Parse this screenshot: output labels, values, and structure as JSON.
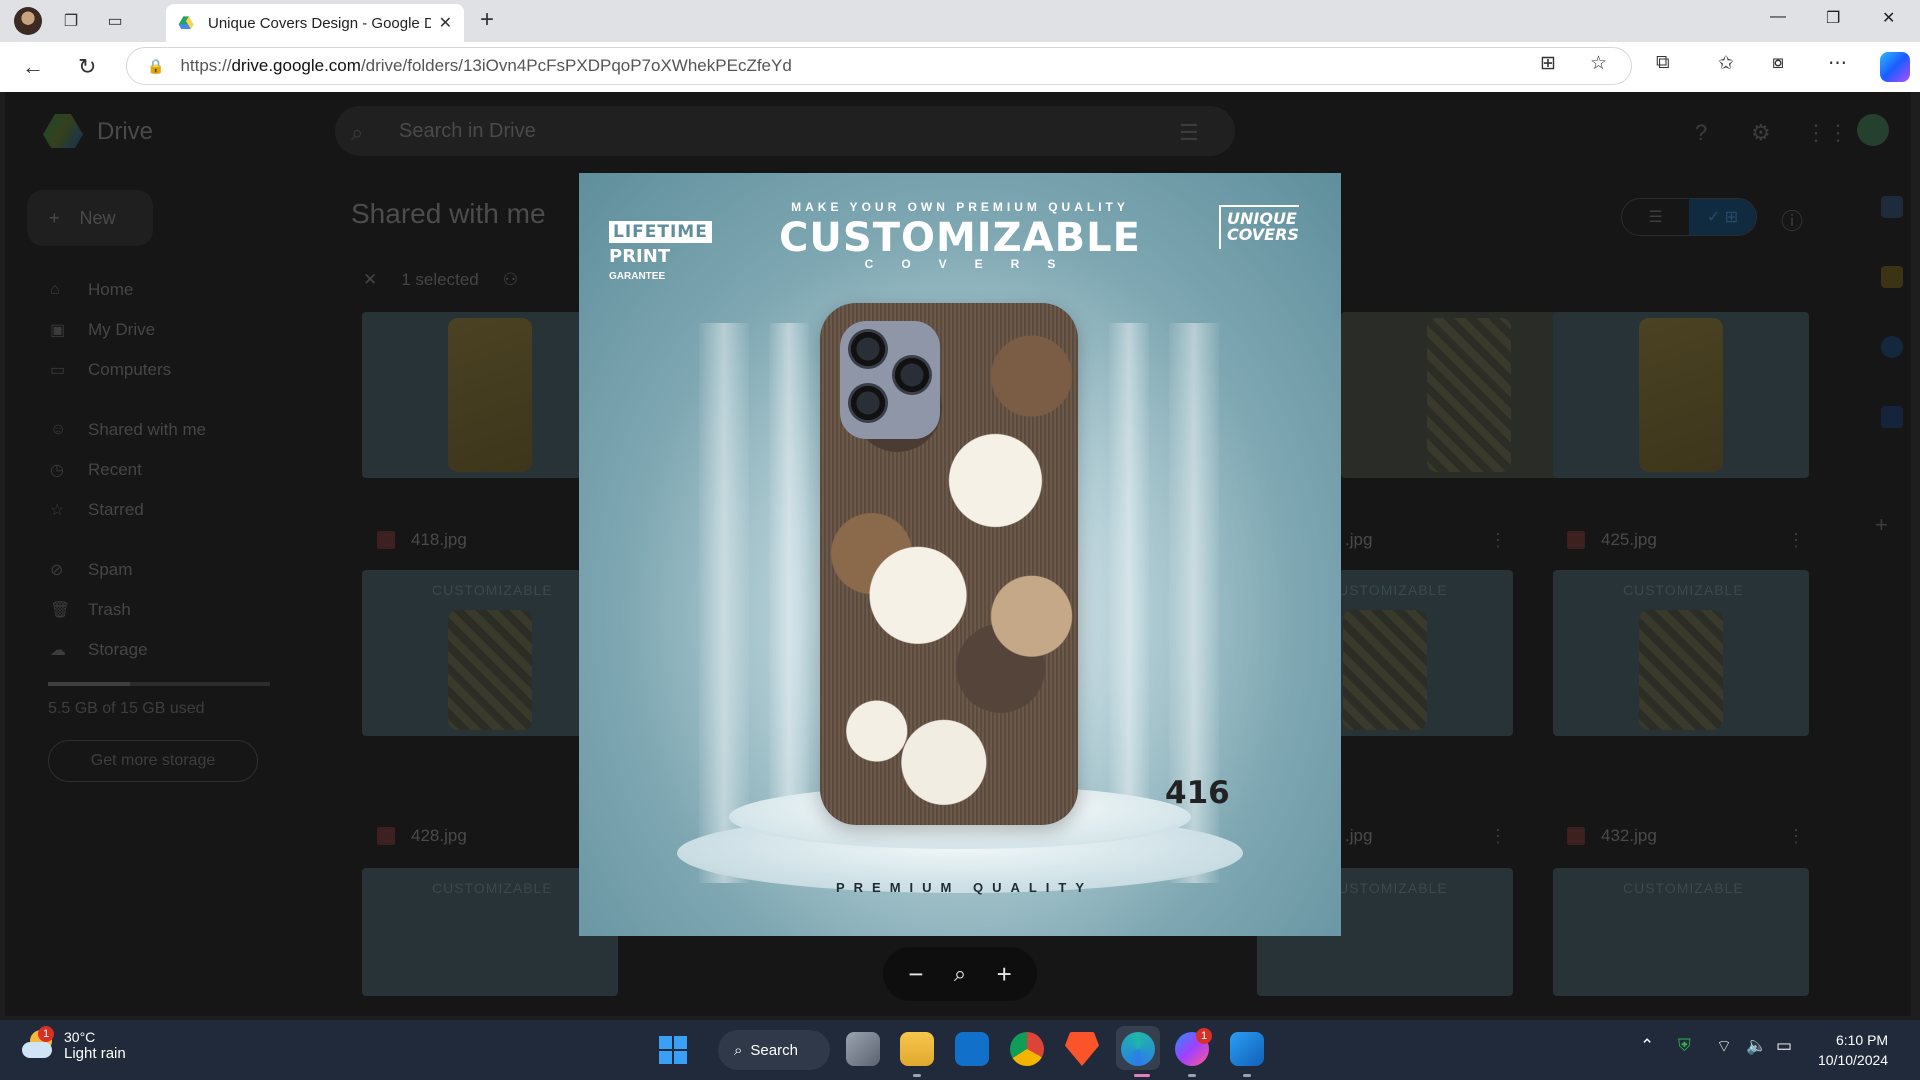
{
  "browser": {
    "tab_title": "Unique Covers Design - Google D",
    "url_prefix": "https://",
    "url_host": "drive.google.com",
    "url_path": "/drive/folders/13iOvn4PcFsPXDPqoP7oXWhekPEcZfeYd"
  },
  "drive": {
    "product": "Drive",
    "search_placeholder": "Search in Drive",
    "new_label": "New",
    "nav": [
      "Home",
      "My Drive",
      "Computers",
      "Shared with me",
      "Recent",
      "Starred",
      "Spam",
      "Trash",
      "Storage"
    ],
    "storage_used_fraction": 0.37,
    "storage_text": "5.5 GB of 15 GB used",
    "get_storage": "Get more storage",
    "page_title": "Shared with me",
    "selected_text": "1 selected",
    "files": [
      "418.jpg",
      ".jpg",
      "425.jpg",
      "428.jpg",
      ".jpg",
      "432.jpg"
    ],
    "thumb_caption": "CUSTOMIZABLE"
  },
  "preview": {
    "lifetime": "LIFETIME",
    "print": "PRINT",
    "guarantee": "GARANTEE",
    "make": "MAKE YOUR OWN PREMIUM QUALITY",
    "customizable": "CUSTOMIZABLE",
    "covers": "COVERS",
    "brand": "UNIQUE COVERS",
    "number": "416",
    "premium": "PREMIUM QUALITY"
  },
  "taskbar": {
    "temp": "30°C",
    "weather": "Light rain",
    "weather_badge": "1",
    "search": "Search",
    "messenger_badge": "1",
    "time": "6:10 PM",
    "date": "10/10/2024"
  },
  "icons": [
    "profile-avatar",
    "workspaces-icon",
    "tab-actions-icon",
    "drive-favicon",
    "close-icon",
    "plus-icon",
    "minimize-icon",
    "restore-icon",
    "back-icon",
    "refresh-icon",
    "lock-icon",
    "apps-icon",
    "star-icon",
    "extensions-icon",
    "favorites-icon",
    "collections-icon",
    "more-icon",
    "copilot-icon",
    "zoom-out-icon",
    "magnifier-icon",
    "zoom-in-icon"
  ]
}
